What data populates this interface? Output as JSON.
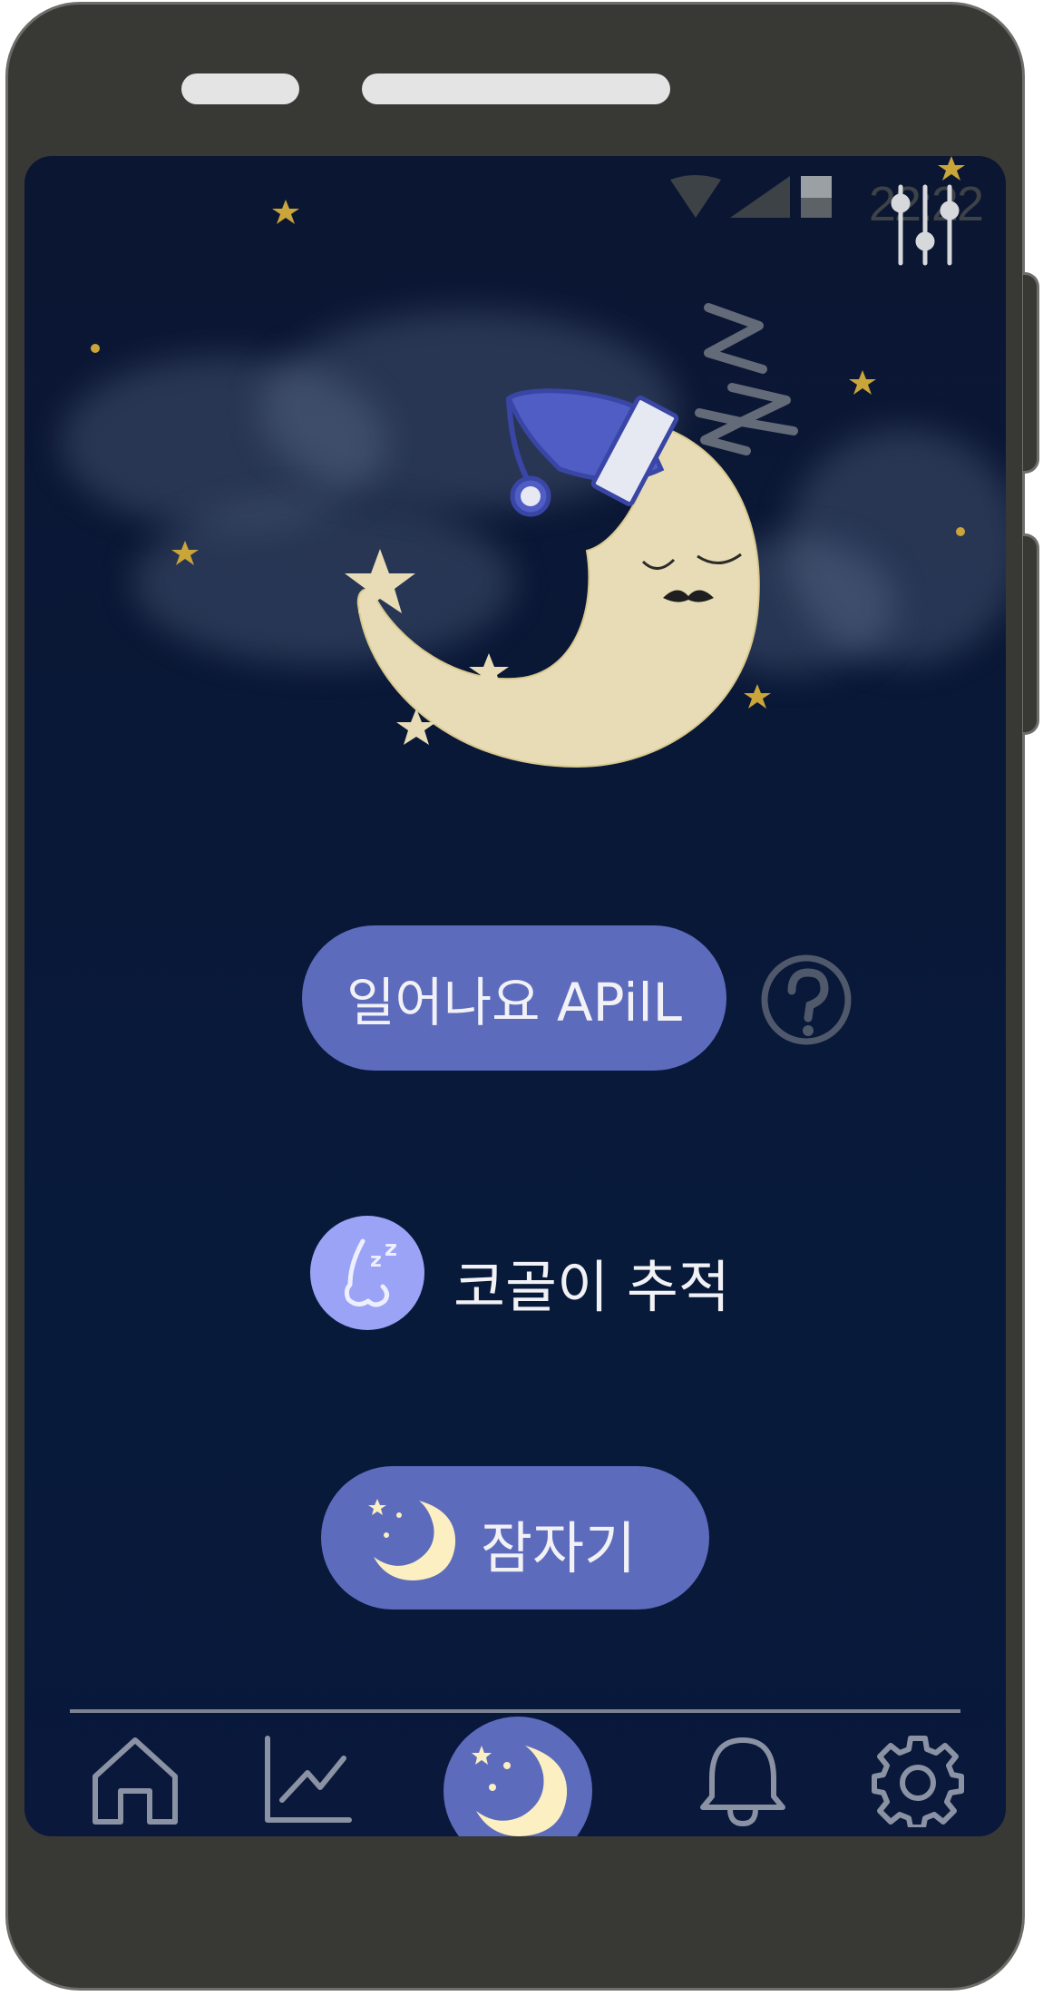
{
  "status_bar": {
    "time": "22:22"
  },
  "hero": {
    "image": "sleeping-moon-with-nightcap"
  },
  "wakeup_button": {
    "label": "일어나요 APilL"
  },
  "help": {
    "icon": "question-circle-icon"
  },
  "snore_tracking": {
    "label": "코골이 추적",
    "icon": "snoring-nose-icon"
  },
  "sleep_button": {
    "label": "잠자기",
    "icon": "moon-stars-icon"
  },
  "bottom_nav": {
    "items": [
      {
        "name": "home",
        "icon": "home-icon"
      },
      {
        "name": "stats",
        "icon": "chart-icon"
      },
      {
        "name": "sleep",
        "icon": "moon-stars-icon",
        "active": true
      },
      {
        "name": "alarm",
        "icon": "bell-icon"
      },
      {
        "name": "settings",
        "icon": "gear-icon"
      }
    ]
  },
  "colors": {
    "background": "#0a1838",
    "accent": "#5d6bbd",
    "moon": "#e8dcb6",
    "nightcap": "#4f5dc4",
    "snore_circle": "#9aa3f5",
    "nav_icon": "#8a92a4",
    "star": "#c9a53a"
  }
}
